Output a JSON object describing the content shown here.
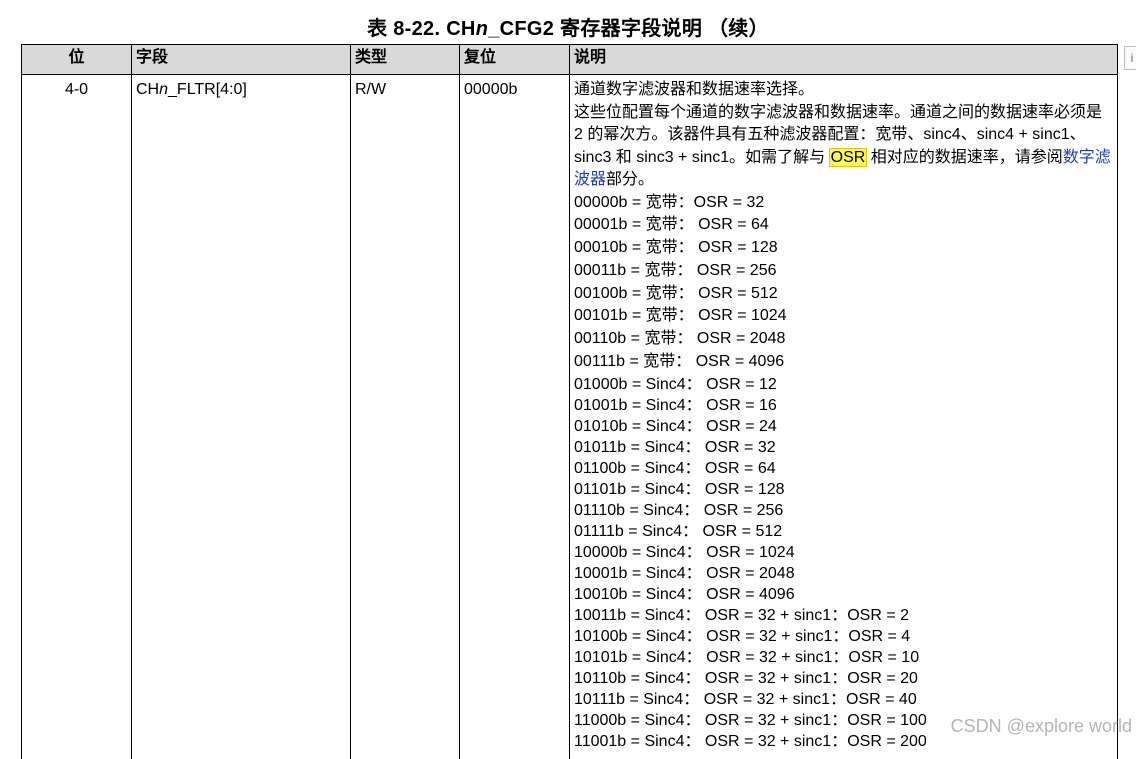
{
  "title": {
    "prefix": "表 8-22. CH",
    "ital": "n",
    "suffix": "_CFG2 寄存器字段说明 （续）"
  },
  "headers": [
    "位",
    "字段",
    "类型",
    "复位",
    "说明"
  ],
  "row": {
    "bit": "4-0",
    "field_prefix": "CH",
    "field_ital": "n",
    "field_suffix": "_FLTR[4:0]",
    "type": "R/W",
    "reset": "00000b",
    "desc_line1": "通道数字滤波器和数据速率选择。",
    "desc_p1": "这些位配置每个通道的数字滤波器和数据速率。通道之间的数据速率必须是 2 的幂次方。该器件具有五种滤波器配置：宽带、sinc4、sinc4 + sinc1、sinc3 和 sinc3 + sinc1。如需了解与",
    "desc_osr": "OSR",
    "desc_p2": "相对应的数据速率，请参阅",
    "desc_link": "数字滤波器",
    "desc_p3": "部分。",
    "encodings": [
      "00000b = 宽带：OSR = 32",
      "00001b = 宽带： OSR = 64",
      "00010b = 宽带： OSR = 128",
      "00011b = 宽带： OSR = 256",
      "00100b = 宽带： OSR = 512",
      "00101b = 宽带： OSR = 1024",
      "00110b = 宽带： OSR = 2048",
      "00111b = 宽带： OSR = 4096"
    ],
    "encodings_sinc": [
      "01000b = Sinc4： OSR = 12",
      "01001b = Sinc4： OSR = 16",
      "01010b = Sinc4： OSR = 24",
      "01011b = Sinc4： OSR = 32",
      "01100b = Sinc4： OSR = 64",
      "01101b = Sinc4： OSR = 128",
      "01110b = Sinc4： OSR = 256",
      "01111b = Sinc4： OSR = 512",
      "10000b = Sinc4： OSR = 1024",
      "10001b = Sinc4： OSR = 2048",
      "10010b = Sinc4： OSR = 4096",
      "10011b = Sinc4： OSR = 32 + sinc1：OSR = 2",
      "10100b = Sinc4： OSR = 32 + sinc1：OSR = 4",
      "10101b = Sinc4： OSR = 32 + sinc1：OSR = 10",
      "10110b = Sinc4： OSR = 32 + sinc1：OSR = 20",
      "10111b = Sinc4： OSR = 32 + sinc1：OSR = 40",
      "11000b = Sinc4： OSR = 32 + sinc1：OSR = 100",
      "11001b = Sinc4： OSR = 32 + sinc1：OSR = 200"
    ]
  },
  "side_tab": "i",
  "watermark": "CSDN @explore world"
}
